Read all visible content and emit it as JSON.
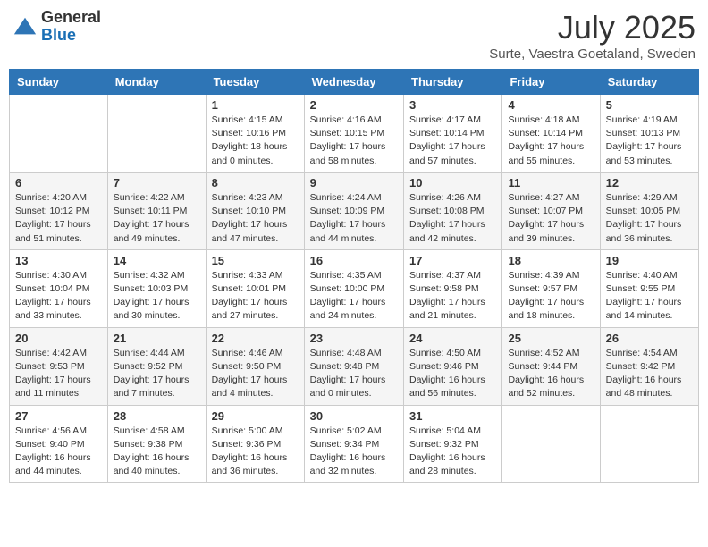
{
  "header": {
    "logo_general": "General",
    "logo_blue": "Blue",
    "month": "July 2025",
    "location": "Surte, Vaestra Goetaland, Sweden"
  },
  "days_of_week": [
    "Sunday",
    "Monday",
    "Tuesday",
    "Wednesday",
    "Thursday",
    "Friday",
    "Saturday"
  ],
  "weeks": [
    [
      {
        "day": "",
        "content": ""
      },
      {
        "day": "",
        "content": ""
      },
      {
        "day": "1",
        "content": "Sunrise: 4:15 AM\nSunset: 10:16 PM\nDaylight: 18 hours\nand 0 minutes."
      },
      {
        "day": "2",
        "content": "Sunrise: 4:16 AM\nSunset: 10:15 PM\nDaylight: 17 hours\nand 58 minutes."
      },
      {
        "day": "3",
        "content": "Sunrise: 4:17 AM\nSunset: 10:14 PM\nDaylight: 17 hours\nand 57 minutes."
      },
      {
        "day": "4",
        "content": "Sunrise: 4:18 AM\nSunset: 10:14 PM\nDaylight: 17 hours\nand 55 minutes."
      },
      {
        "day": "5",
        "content": "Sunrise: 4:19 AM\nSunset: 10:13 PM\nDaylight: 17 hours\nand 53 minutes."
      }
    ],
    [
      {
        "day": "6",
        "content": "Sunrise: 4:20 AM\nSunset: 10:12 PM\nDaylight: 17 hours\nand 51 minutes."
      },
      {
        "day": "7",
        "content": "Sunrise: 4:22 AM\nSunset: 10:11 PM\nDaylight: 17 hours\nand 49 minutes."
      },
      {
        "day": "8",
        "content": "Sunrise: 4:23 AM\nSunset: 10:10 PM\nDaylight: 17 hours\nand 47 minutes."
      },
      {
        "day": "9",
        "content": "Sunrise: 4:24 AM\nSunset: 10:09 PM\nDaylight: 17 hours\nand 44 minutes."
      },
      {
        "day": "10",
        "content": "Sunrise: 4:26 AM\nSunset: 10:08 PM\nDaylight: 17 hours\nand 42 minutes."
      },
      {
        "day": "11",
        "content": "Sunrise: 4:27 AM\nSunset: 10:07 PM\nDaylight: 17 hours\nand 39 minutes."
      },
      {
        "day": "12",
        "content": "Sunrise: 4:29 AM\nSunset: 10:05 PM\nDaylight: 17 hours\nand 36 minutes."
      }
    ],
    [
      {
        "day": "13",
        "content": "Sunrise: 4:30 AM\nSunset: 10:04 PM\nDaylight: 17 hours\nand 33 minutes."
      },
      {
        "day": "14",
        "content": "Sunrise: 4:32 AM\nSunset: 10:03 PM\nDaylight: 17 hours\nand 30 minutes."
      },
      {
        "day": "15",
        "content": "Sunrise: 4:33 AM\nSunset: 10:01 PM\nDaylight: 17 hours\nand 27 minutes."
      },
      {
        "day": "16",
        "content": "Sunrise: 4:35 AM\nSunset: 10:00 PM\nDaylight: 17 hours\nand 24 minutes."
      },
      {
        "day": "17",
        "content": "Sunrise: 4:37 AM\nSunset: 9:58 PM\nDaylight: 17 hours\nand 21 minutes."
      },
      {
        "day": "18",
        "content": "Sunrise: 4:39 AM\nSunset: 9:57 PM\nDaylight: 17 hours\nand 18 minutes."
      },
      {
        "day": "19",
        "content": "Sunrise: 4:40 AM\nSunset: 9:55 PM\nDaylight: 17 hours\nand 14 minutes."
      }
    ],
    [
      {
        "day": "20",
        "content": "Sunrise: 4:42 AM\nSunset: 9:53 PM\nDaylight: 17 hours\nand 11 minutes."
      },
      {
        "day": "21",
        "content": "Sunrise: 4:44 AM\nSunset: 9:52 PM\nDaylight: 17 hours\nand 7 minutes."
      },
      {
        "day": "22",
        "content": "Sunrise: 4:46 AM\nSunset: 9:50 PM\nDaylight: 17 hours\nand 4 minutes."
      },
      {
        "day": "23",
        "content": "Sunrise: 4:48 AM\nSunset: 9:48 PM\nDaylight: 17 hours\nand 0 minutes."
      },
      {
        "day": "24",
        "content": "Sunrise: 4:50 AM\nSunset: 9:46 PM\nDaylight: 16 hours\nand 56 minutes."
      },
      {
        "day": "25",
        "content": "Sunrise: 4:52 AM\nSunset: 9:44 PM\nDaylight: 16 hours\nand 52 minutes."
      },
      {
        "day": "26",
        "content": "Sunrise: 4:54 AM\nSunset: 9:42 PM\nDaylight: 16 hours\nand 48 minutes."
      }
    ],
    [
      {
        "day": "27",
        "content": "Sunrise: 4:56 AM\nSunset: 9:40 PM\nDaylight: 16 hours\nand 44 minutes."
      },
      {
        "day": "28",
        "content": "Sunrise: 4:58 AM\nSunset: 9:38 PM\nDaylight: 16 hours\nand 40 minutes."
      },
      {
        "day": "29",
        "content": "Sunrise: 5:00 AM\nSunset: 9:36 PM\nDaylight: 16 hours\nand 36 minutes."
      },
      {
        "day": "30",
        "content": "Sunrise: 5:02 AM\nSunset: 9:34 PM\nDaylight: 16 hours\nand 32 minutes."
      },
      {
        "day": "31",
        "content": "Sunrise: 5:04 AM\nSunset: 9:32 PM\nDaylight: 16 hours\nand 28 minutes."
      },
      {
        "day": "",
        "content": ""
      },
      {
        "day": "",
        "content": ""
      }
    ]
  ]
}
